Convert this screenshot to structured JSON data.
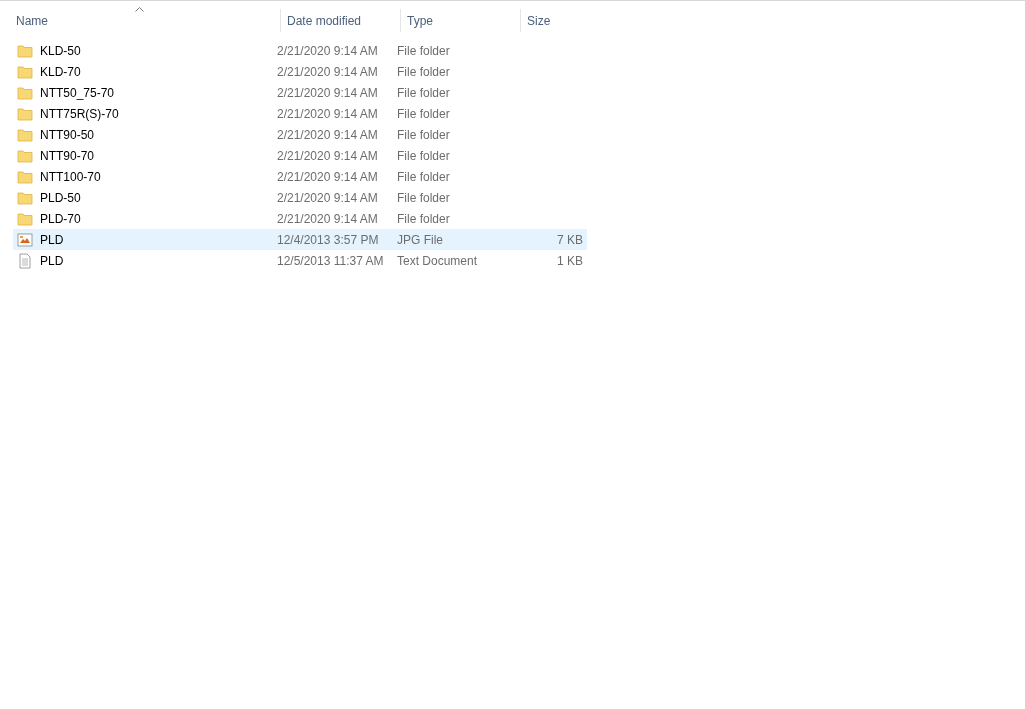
{
  "columns": [
    {
      "label": "Name",
      "sorted": true
    },
    {
      "label": "Date modified",
      "sorted": false
    },
    {
      "label": "Type",
      "sorted": false
    },
    {
      "label": "Size",
      "sorted": false
    }
  ],
  "rows": [
    {
      "kind": "folder",
      "name": "KLD-50",
      "date": "2/21/2020 9:14 AM",
      "type": "File folder",
      "selected": false
    },
    {
      "kind": "folder",
      "name": "KLD-70",
      "date": "2/21/2020 9:14 AM",
      "type": "File folder",
      "selected": false
    },
    {
      "kind": "folder",
      "name": "NTT50_75-70",
      "date": "2/21/2020 9:14 AM",
      "type": "File folder",
      "selected": false
    },
    {
      "kind": "folder",
      "name": "NTT75R(S)-70",
      "date": "2/21/2020 9:14 AM",
      "type": "File folder",
      "selected": false
    },
    {
      "kind": "folder",
      "name": "NTT90-50",
      "date": "2/21/2020 9:14 AM",
      "type": "File folder",
      "selected": false
    },
    {
      "kind": "folder",
      "name": "NTT90-70",
      "date": "2/21/2020 9:14 AM",
      "type": "File folder",
      "selected": false
    },
    {
      "kind": "folder",
      "name": "NTT100-70",
      "date": "2/21/2020 9:14 AM",
      "type": "File folder",
      "selected": false
    },
    {
      "kind": "folder",
      "name": "PLD-50",
      "date": "2/21/2020 9:14 AM",
      "type": "File folder",
      "selected": false
    },
    {
      "kind": "folder",
      "name": "PLD-70",
      "date": "2/21/2020 9:14 AM",
      "type": "File folder",
      "selected": false
    },
    {
      "kind": "image",
      "name": "PLD",
      "date": "12/4/2013 3:57 PM",
      "type": "JPG File",
      "size": "7 KB",
      "selected": true
    },
    {
      "kind": "text",
      "name": "PLD",
      "date": "12/5/2013 11:37 AM",
      "type": "Text Document",
      "size": "1 KB",
      "selected": false
    }
  ]
}
